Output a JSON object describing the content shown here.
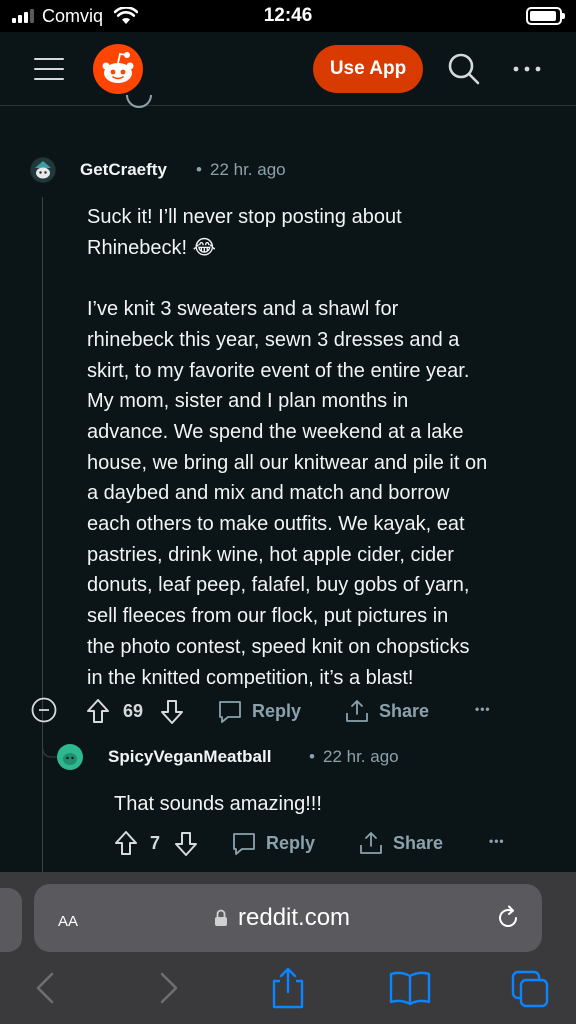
{
  "status": {
    "carrier": "Comviq",
    "time": "12:46"
  },
  "header": {
    "use_app_label": "Use App",
    "icons": [
      "hamburger-menu-icon",
      "reddit-logo",
      "search-icon",
      "more-icon"
    ]
  },
  "comments": [
    {
      "username": "GetCraefty",
      "time_ago": "22 hr. ago",
      "body_lines": [
        "Suck it! I’ll never stop posting about",
        "Rhinebeck! 😂",
        "",
        "I’ve knit 3 sweaters and a shawl for",
        "rhinebeck this year, sewn 3 dresses and a",
        "skirt, to my favorite event of the entire year.",
        "My mom, sister and I plan months in",
        "advance. We spend the weekend at a lake",
        "house, we bring all our knitwear and pile it on",
        "a daybed and mix and match and borrow",
        "each others to make outfits. We kayak, eat",
        "pastries, drink wine, hot apple cider, cider",
        "donuts, leaf peep, falafel, buy gobs of yarn,",
        "sell fleeces from our flock, put pictures in",
        "the photo contest, speed knit on chopsticks",
        "in the knitted competition, it’s a blast!"
      ],
      "votes": "69",
      "reply_label": "Reply",
      "share_label": "Share"
    },
    {
      "username": "SpicyVeganMeatball",
      "time_ago": "22 hr. ago",
      "body": "That sounds amazing!!!",
      "votes": "7",
      "reply_label": "Reply",
      "share_label": "Share"
    }
  ],
  "meta_separator": "•",
  "more_label": "•••",
  "browser": {
    "text_size_label": "AA",
    "url": "reddit.com"
  }
}
